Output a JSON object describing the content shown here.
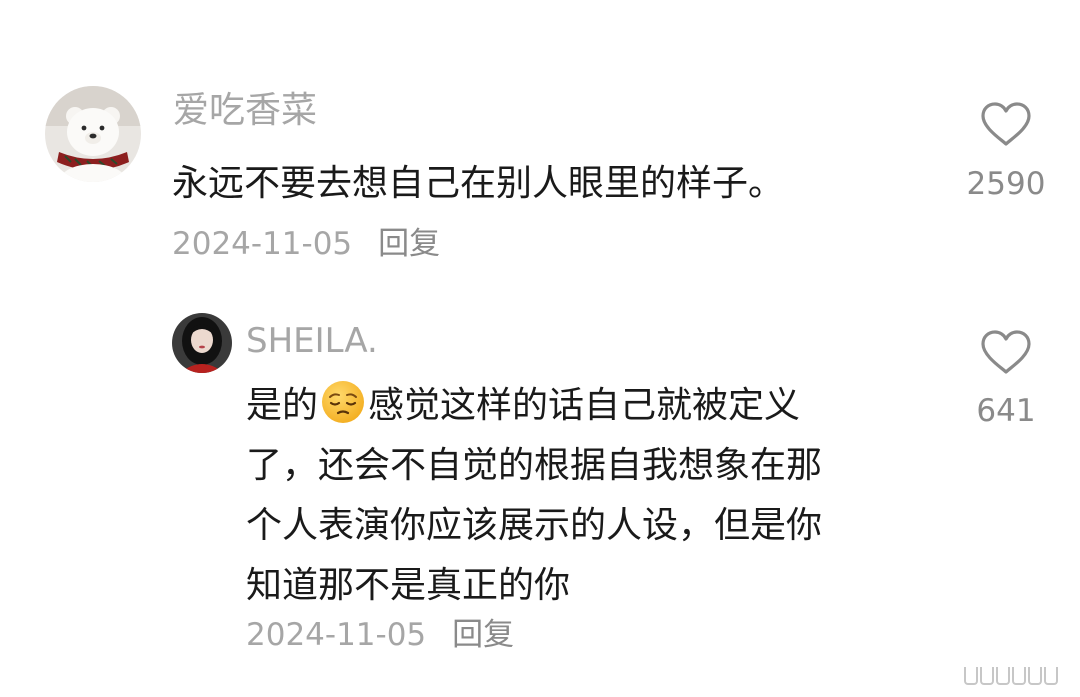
{
  "comments": [
    {
      "username": "爱吃香菜",
      "text": "永远不要去想自己在别人眼里的样子。",
      "date": "2024-11-05",
      "reply_label": "回复",
      "likes": "2590",
      "avatar": "polar-bear-avatar"
    }
  ],
  "reply": {
    "username": "SHEILA.",
    "text_before_emoji": "是的",
    "emoji": "pensive-face-emoji",
    "text_after_emoji": "感觉这样的话自己就被定义",
    "lines": [
      "了，还会不自觉的根据自我想象在那",
      "个人表演你应该展示的人设，但是你",
      "知道那不是真正的你"
    ],
    "date": "2024-11-05",
    "reply_label": "回复",
    "likes": "641",
    "avatar": "girl-portrait-avatar"
  },
  "icons": {
    "like": "heart-outline-icon"
  }
}
